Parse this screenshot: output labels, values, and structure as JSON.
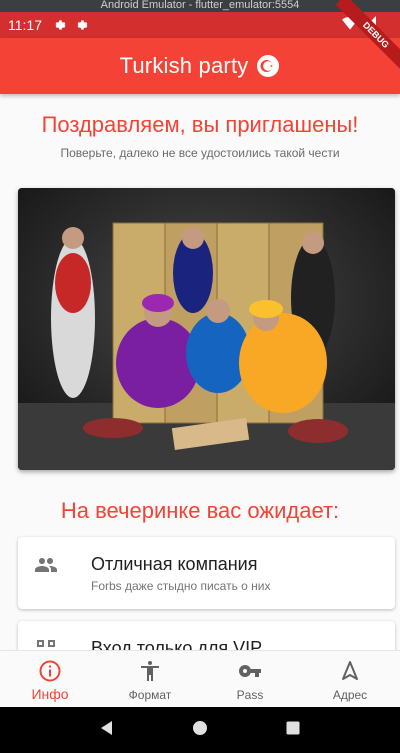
{
  "emulator": {
    "title": "Android Emulator - flutter_emulator:5554"
  },
  "status_bar": {
    "time": "11:17",
    "color": "#d32f2f"
  },
  "app_bar": {
    "title": "Turkish party",
    "flag_icon": "turkey-flag-icon",
    "color": "#f44336"
  },
  "debug_banner": {
    "label": "DEBUG"
  },
  "header": {
    "headline": "Поздравляем, вы приглашены!",
    "subheadline": "Поверьте, далеко не все удостоились такой чести"
  },
  "section": {
    "title": "На вечеринке вас ожидает:"
  },
  "cards": [
    {
      "icon": "people-icon",
      "title": "Отличная компания",
      "subtitle": "Forbs даже стыдно писать о них"
    },
    {
      "icon": "qr-code-icon",
      "title": "Вход только для VIP",
      "subtitle": ""
    }
  ],
  "bottom_nav": {
    "items": [
      {
        "icon": "info-icon",
        "label": "Инфо",
        "active": true
      },
      {
        "icon": "accessibility-icon",
        "label": "Формат",
        "active": false
      },
      {
        "icon": "key-icon",
        "label": "Pass",
        "active": false
      },
      {
        "icon": "navigation-icon",
        "label": "Адрес",
        "active": false
      }
    ]
  },
  "colors": {
    "accent": "#f44336",
    "text_primary": "#212121",
    "text_secondary": "#757575"
  }
}
